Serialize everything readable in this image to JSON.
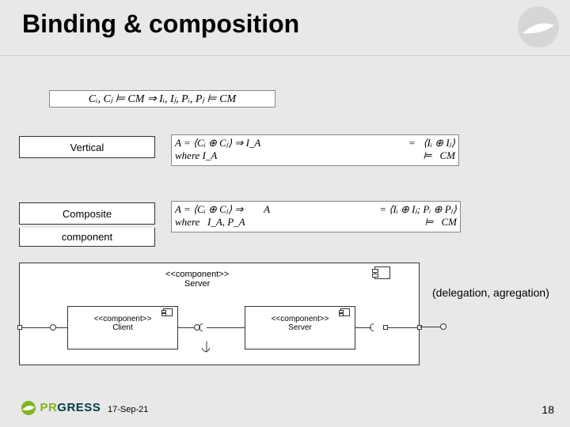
{
  "title": "Binding & composition",
  "equations": {
    "top": "Cᵢ, Cⱼ ⊨ CM ⇒ Iᵢ, Iⱼ, Pᵢ, Pⱼ ⊨ CM",
    "vertical_l": "A = ⟨Cᵢ ⊕ Cⱼ⟩ ⇒ I_A",
    "vertical_r": "=   ⟨Iᵢ ⊕ Iⱼ⟩",
    "vertical_wl": "where I_A",
    "vertical_wr": "⊨   CM",
    "composite_l": "A = ⟨Cᵢ ⊕ Cⱼ⟩ ⇒        A",
    "composite_r": "= ⟨Iᵢ ⊕ Iⱼ; Pᵢ ⊕ Pⱼ⟩",
    "composite_wl": "where   I_A, P_A",
    "composite_wr": "⊨   CM"
  },
  "labels": {
    "vertical": "Vertical",
    "composite": "Composite",
    "component": "component"
  },
  "diagram": {
    "outer_stereotype": "<<component>>",
    "outer_name": "Server",
    "client_stereotype": "<<component>>",
    "client_name": "Client",
    "server_stereotype": "<<component>>",
    "server_name": "Server"
  },
  "annotation": "(delegation, agregation)",
  "footer": {
    "brand_left": "PR",
    "brand_right": "GRESS",
    "date": "17-Sep-21",
    "page": "18"
  }
}
